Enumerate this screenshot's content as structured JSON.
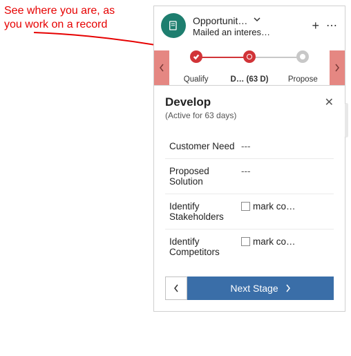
{
  "annotation": {
    "text": "See where you are, as\nyou work on a record"
  },
  "header": {
    "title": "Opportunit…",
    "subtitle": "Mailed an interes…"
  },
  "bpf": {
    "stages": [
      {
        "label": "Qualify",
        "state": "done"
      },
      {
        "label": "D…  (63 D)",
        "state": "active"
      },
      {
        "label": "Propose",
        "state": "next"
      }
    ]
  },
  "detail": {
    "stage_name": "Develop",
    "active_text": "(Active for 63 days)",
    "fields": [
      {
        "label": "Customer Need",
        "value": "---",
        "type": "text"
      },
      {
        "label": "Proposed Solution",
        "value": "---",
        "type": "text"
      },
      {
        "label": "Identify Stakeholders",
        "check_label": "mark co…",
        "type": "check"
      },
      {
        "label": "Identify Competitors",
        "check_label": "mark co…",
        "type": "check"
      }
    ]
  },
  "footer": {
    "next_label": "Next Stage"
  }
}
